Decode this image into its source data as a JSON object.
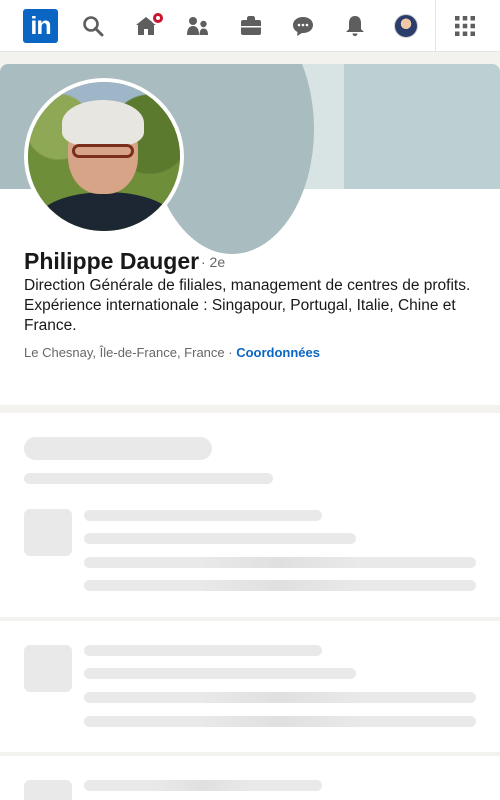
{
  "nav": {
    "logo_text": "in",
    "items": [
      {
        "name": "search",
        "icon": "search-icon"
      },
      {
        "name": "home",
        "icon": "home-icon",
        "has_badge": true
      },
      {
        "name": "network",
        "icon": "people-icon"
      },
      {
        "name": "jobs",
        "icon": "briefcase-icon"
      },
      {
        "name": "messaging",
        "icon": "chat-icon"
      },
      {
        "name": "notifications",
        "icon": "bell-icon"
      },
      {
        "name": "me",
        "icon": "avatar"
      },
      {
        "name": "apps",
        "icon": "grid-icon"
      }
    ]
  },
  "profile": {
    "name": "Philippe Dauger",
    "degree": "· 2e",
    "headline": "Direction Générale de filiales, management de centres de profits. Expérience internationale : Singapour, Portugal, Italie, Chine et France.",
    "location": "Le Chesnay, Île-de-France, France",
    "separator": " · ",
    "contact_link": "Coordonnées"
  },
  "colors": {
    "brand": "#0a66c2",
    "badge": "#cb112d",
    "banner": "#a9bcbf",
    "page_bg": "#f3f2ef"
  }
}
